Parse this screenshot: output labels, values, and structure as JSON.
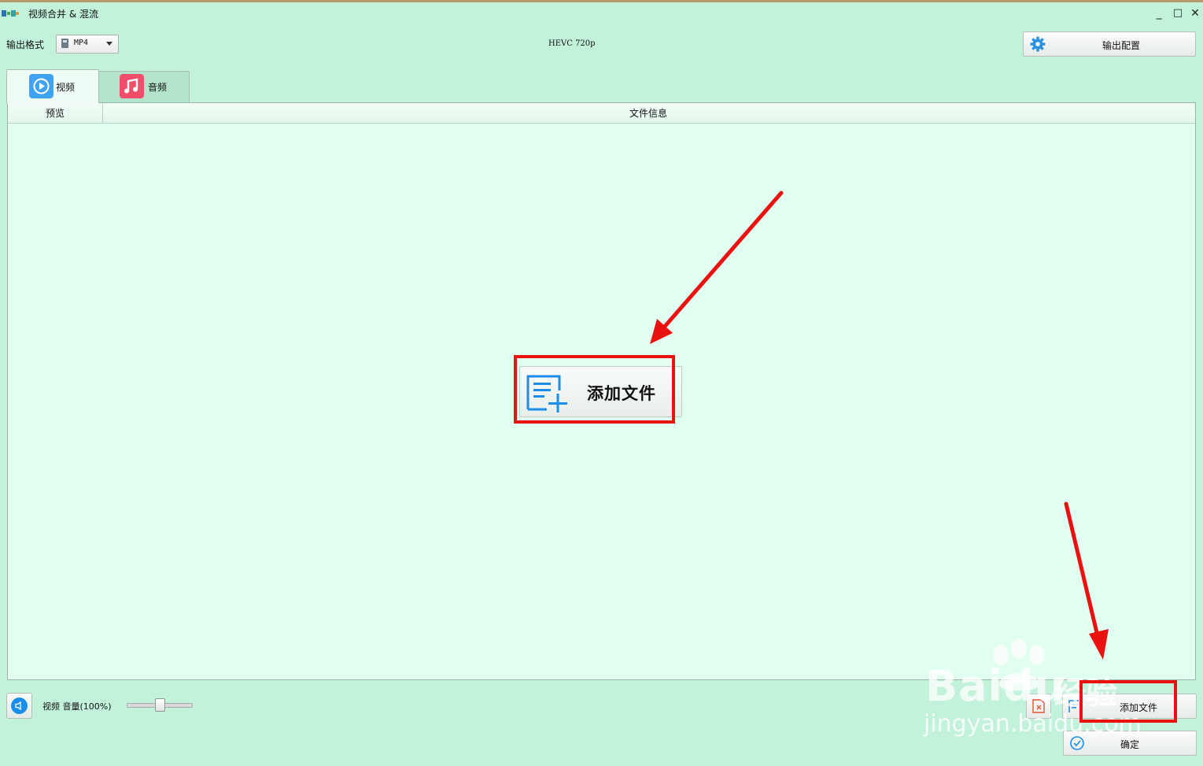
{
  "window": {
    "title": "视频合并 & 混流",
    "controls": {
      "minimize": "_",
      "maximize": "□",
      "close": "✕"
    }
  },
  "toolbar": {
    "format_label": "输出格式",
    "format_value": "MP4",
    "codec_info": "HEVC 720p",
    "config_button": "输出配置"
  },
  "tabs": [
    {
      "label": "视频",
      "icon": "play-circle-icon",
      "active": true,
      "color": "#3fa3f2"
    },
    {
      "label": "音频",
      "icon": "music-note-icon",
      "active": false,
      "color": "#f24e6c"
    }
  ],
  "list": {
    "columns": [
      "预览",
      "文件信息"
    ],
    "add_file_label": "添加文件"
  },
  "bottom": {
    "volume_label": "视频 音量(100%)",
    "volume_level": 1.0,
    "add_file_button": "添加文件",
    "confirm_button": "确定"
  },
  "watermark": {
    "brand": "Baidu",
    "product": "经验",
    "url": "jingyan.baidu.com"
  },
  "colors": {
    "background": "#c2f2da",
    "panel": "#e1fff0",
    "accent_blue": "#1a8ee8",
    "annotation_red": "#ea1111"
  }
}
